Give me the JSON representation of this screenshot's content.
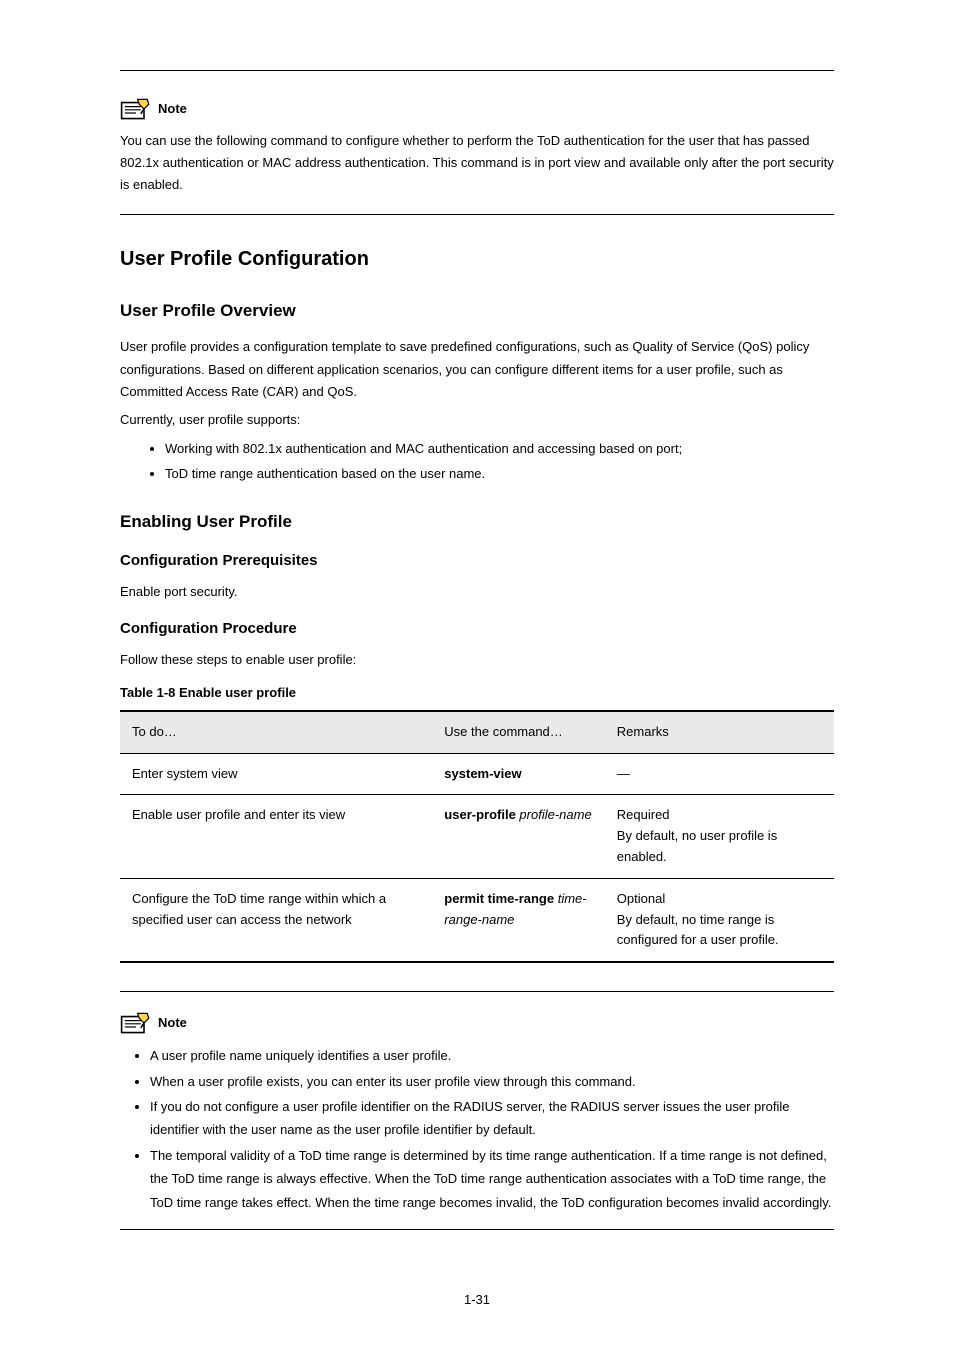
{
  "note_top": {
    "label": "Note",
    "paragraphs": [
      "You can use the following command to configure whether to perform the ToD authentication for the user that has passed 802.1x authentication or MAC address authentication. This command is in port view and available only after the port security is enabled."
    ]
  },
  "section": {
    "title": "User Profile Configuration",
    "overview_heading": "User Profile Overview",
    "overview_paragraphs": [
      "User profile provides a configuration template to save predefined configurations, such as Quality of Service (QoS) policy configurations. Based on different application scenarios, you can configure different items for a user profile, such as Committed Access Rate (CAR) and QoS.",
      "Currently, user profile supports:"
    ],
    "overview_bullets": [
      "Working with 802.1x authentication and MAC authentication and accessing based on port;",
      "ToD time range authentication based on the user name."
    ]
  },
  "enabling": {
    "heading": "Enabling User Profile",
    "prereq_heading": "Configuration Prerequisites",
    "prereq_text": "Enable port security.",
    "proc_heading": "Configuration Procedure",
    "proc_text": "Follow these steps to enable user profile:",
    "table_caption": "Table 1-8 Enable user profile",
    "table": {
      "headers": [
        "To do…",
        "Use the command…",
        "Remarks"
      ],
      "rows": [
        {
          "todo": "Enter system view",
          "cmd_bold": "system-view",
          "cmd_italic": "",
          "remarks": "—"
        },
        {
          "todo": "Enable user profile and enter its view",
          "cmd_bold": "user-profile ",
          "cmd_italic": "profile-name",
          "remarks": "Required\nBy default, no user profile is enabled."
        },
        {
          "todo": "Configure the ToD time range within which a specified user can access the network",
          "cmd_bold": "permit time-range ",
          "cmd_italic": "time-range-name",
          "remarks": "Optional\nBy default, no time range is configured for a user profile."
        }
      ]
    }
  },
  "note_bottom": {
    "label": "Note",
    "bullets": [
      "A user profile name uniquely identifies a user profile.",
      "When a user profile exists, you can enter its user profile view through this command.",
      "If you do not configure a user profile identifier on the RADIUS server, the RADIUS server issues the user profile identifier with the user name as the user profile identifier by default.",
      "The temporal validity of a ToD time range is determined by its time range authentication. If a time range is not defined, the ToD time range is always effective. When the ToD time range authentication associates with a ToD time range, the ToD time range takes effect. When the time range becomes invalid, the ToD configuration becomes invalid accordingly."
    ]
  },
  "page_number": "1-31"
}
